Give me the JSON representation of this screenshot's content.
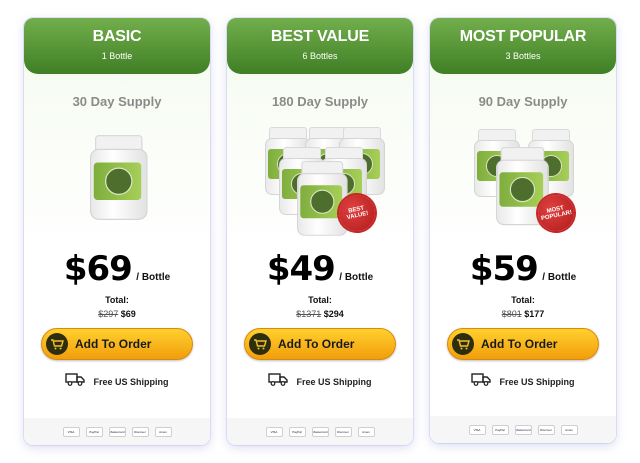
{
  "plans": [
    {
      "name": "BASIC",
      "qty": "1 Bottle",
      "supply": "30 Day Supply",
      "price": "$69",
      "per": "/ Bottle",
      "total_label": "Total:",
      "total_old": "$297",
      "total_new": "$69",
      "button": "Add To Order",
      "shipping": "Free US Shipping",
      "badge": ""
    },
    {
      "name": "BEST VALUE",
      "qty": "6 Bottles",
      "supply": "180 Day Supply",
      "price": "$49",
      "per": "/ Bottle",
      "total_label": "Total:",
      "total_old": "$1371",
      "total_new": "$294",
      "button": "Add To Order",
      "shipping": "Free US Shipping",
      "badge": "BEST VALUE!"
    },
    {
      "name": "MOST POPULAR",
      "qty": "3 Bottles",
      "supply": "90 Day Supply",
      "price": "$59",
      "per": "/ Bottle",
      "total_label": "Total:",
      "total_old": "$801",
      "total_new": "$177",
      "button": "Add To Order",
      "shipping": "Free US Shipping",
      "badge": "MOST POPULAR!"
    }
  ],
  "payment_methods": [
    "VISA",
    "PayPal",
    "Mastercard",
    "Discover",
    "Amex"
  ],
  "colors": {
    "header_green": "#4f8f31",
    "button_yellow": "#f8b81a",
    "badge_red": "#c62222"
  }
}
